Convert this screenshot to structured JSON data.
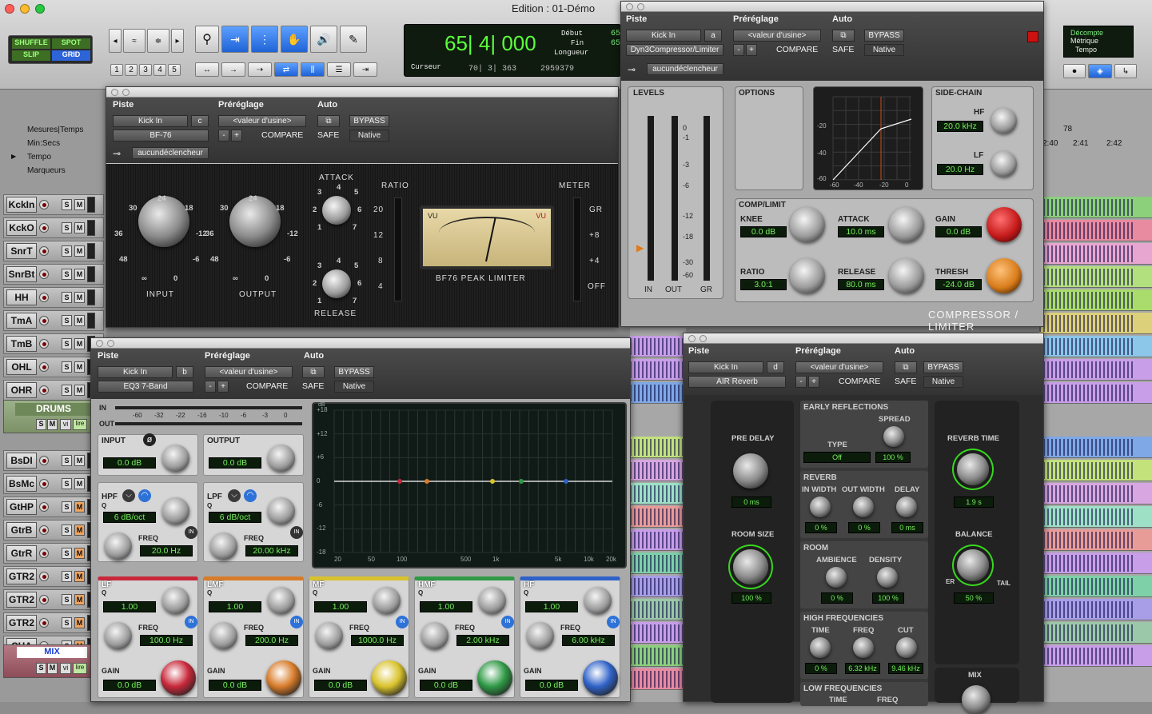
{
  "window": {
    "title": "Edition : 01-Démo"
  },
  "toolbar": {
    "modes": [
      "SHUFFLE",
      "SPOT",
      "SLIP",
      "GRID"
    ],
    "numbers": [
      "1",
      "2",
      "3",
      "4",
      "5"
    ],
    "counter": "65| 4| 000",
    "labels": {
      "start": "Début",
      "end": "Fin",
      "length": "Longueur",
      "cursor": "Curseur"
    },
    "start_val": "65",
    "end_val": "65",
    "cursor_val": "70| 3| 363",
    "sample_val": "2959379",
    "decompte": "Décompte",
    "metrique": "Métrique",
    "tempo": "Tempo"
  },
  "ruler": {
    "rows": [
      "Mesures|Temps",
      "Min:Secs",
      "Tempo",
      "Marqueurs"
    ],
    "bar": "78",
    "times": [
      "2:40",
      "2:41",
      "2:42"
    ]
  },
  "tracks": [
    {
      "name": "KckIn"
    },
    {
      "name": "KckO"
    },
    {
      "name": "SnrT"
    },
    {
      "name": "SnrBt"
    },
    {
      "name": "HH"
    },
    {
      "name": "TmA"
    },
    {
      "name": "TmB"
    },
    {
      "name": "OHL"
    },
    {
      "name": "OHR"
    },
    {
      "name": "BsDI"
    },
    {
      "name": "BsMc"
    },
    {
      "name": "GtHP"
    },
    {
      "name": "GtrB"
    },
    {
      "name": "GtrR"
    },
    {
      "name": "GTR2"
    },
    {
      "name": "GTR2"
    },
    {
      "name": "GTR2"
    },
    {
      "name": "CHA"
    }
  ],
  "group": {
    "drums": "DRUMS",
    "mix": "MIX",
    "vi": "vi",
    "lire": "lire"
  },
  "common": {
    "piste": "Piste",
    "preset": "Préréglage",
    "auto": "Auto",
    "track": "Kick In",
    "factory": "<valeur d'usine>",
    "compare": "COMPARE",
    "bypass": "BYPASS",
    "safe": "SAFE",
    "native": "Native",
    "key": "aucundéclencheur",
    "minus": "-",
    "plus": "+"
  },
  "bf76": {
    "letter": "c",
    "plugin": "BF-76",
    "input": "INPUT",
    "output": "OUTPUT",
    "attack": "ATTACK",
    "release": "RELEASE",
    "ratio": "RATIO",
    "meter": "METER",
    "ratios": [
      "20",
      "12",
      "8",
      "4"
    ],
    "meters": [
      "GR",
      "+8",
      "+4",
      "OFF"
    ],
    "title": "BF76 PEAK LIMITER",
    "vu": "VU",
    "in_ticks": [
      "24",
      "30",
      "18",
      "36",
      "-12",
      "48",
      "-6",
      "∞",
      "0"
    ],
    "out_ticks": [
      "24",
      "30",
      "18",
      "36",
      "-12",
      "48",
      "-6",
      "∞",
      "0"
    ],
    "atk_ticks": [
      "3",
      "4",
      "5",
      "2",
      "6",
      "1",
      "7"
    ],
    "rel_ticks": [
      "3",
      "4",
      "5",
      "2",
      "6",
      "1",
      "7"
    ]
  },
  "dyn3": {
    "letter": "a",
    "plugin": "Dyn3Compressor/Limiter",
    "levels": "LEVELS",
    "options": "OPTIONS",
    "sidechain": "SIDE-CHAIN",
    "complimit": "COMP/LIMIT",
    "hf": "HF",
    "hf_val": "20.0 kHz",
    "lf": "LF",
    "lf_val": "20.0 Hz",
    "knee": "KNEE",
    "knee_val": "0.0 dB",
    "attack": "ATTACK",
    "attack_val": "10.0 ms",
    "gain": "GAIN",
    "gain_val": "0.0 dB",
    "ratio": "RATIO",
    "ratio_val": "3.0:1",
    "release": "RELEASE",
    "release_val": "80.0 ms",
    "thresh": "THRESH",
    "thresh_val": "-24.0 dB",
    "scale": [
      "0",
      "-1",
      "-3",
      "-6",
      "-12",
      "-18",
      "-30",
      "-60"
    ],
    "in": "IN",
    "out": "OUT",
    "gr": "GR",
    "brand": "COMPRESSOR / LIMITER",
    "graph_y": [
      "0",
      "-20",
      "-40",
      "-60"
    ],
    "graph_x": [
      "-60",
      "-40",
      "-20",
      "0"
    ]
  },
  "eq3": {
    "letter": "b",
    "plugin": "EQ3 7-Band",
    "in": "IN",
    "out": "OUT",
    "meter_scale": [
      "-60",
      "-32",
      "-22",
      "-16",
      "-10",
      "-6",
      "-3",
      "0"
    ],
    "input": "INPUT",
    "input_val": "0.0 dB",
    "output": "OUTPUT",
    "output_val": "0.0 dB",
    "hpf": "HPF",
    "hpf_q": "Q",
    "hpf_slope": "6 dB/oct",
    "hpf_freq": "FREQ",
    "hpf_freq_val": "20.0 Hz",
    "lpf": "LPF",
    "lpf_q": "Q",
    "lpf_slope": "6 dB/oct",
    "lpf_freq": "FREQ",
    "lpf_freq_val": "20.00 kHz",
    "in_btn": "IN",
    "db_scale": [
      "+18",
      "+12",
      "+6",
      "0",
      "-6",
      "-12",
      "-18"
    ],
    "freq_scale": [
      "20",
      "50",
      "100",
      "500",
      "1k",
      "5k",
      "10k",
      "20k"
    ],
    "db_unit": "dB",
    "bands": [
      {
        "name": "LF",
        "q": "1.00",
        "freq": "100.0 Hz",
        "gain": "0.0 dB",
        "color": "#c8283a"
      },
      {
        "name": "LMF",
        "q": "1.00",
        "freq": "200.0 Hz",
        "gain": "0.0 dB",
        "color": "#d87c2a"
      },
      {
        "name": "MF",
        "q": "1.00",
        "freq": "1000.0 Hz",
        "gain": "0.0 dB",
        "color": "#d9c32c"
      },
      {
        "name": "HMF",
        "q": "1.00",
        "freq": "2.00 kHz",
        "gain": "0.0 dB",
        "color": "#2f9a46"
      },
      {
        "name": "HF",
        "q": "1.00",
        "freq": "6.00 kHz",
        "gain": "0.0 dB",
        "color": "#2f62c8"
      }
    ],
    "q_label": "Q",
    "freq_label": "FREQ",
    "gain_label": "GAIN"
  },
  "air": {
    "letter": "d",
    "plugin": "AIR Reverb",
    "pre_delay": "PRE DELAY",
    "pre_delay_val": "0 ms",
    "room_size": "ROOM SIZE",
    "room_size_val": "100 %",
    "early": "EARLY REFLECTIONS",
    "spread": "SPREAD",
    "type": "TYPE",
    "type_val": "Off",
    "spread_val": "100 %",
    "reverb": "REVERB",
    "in_width": "IN WIDTH",
    "out_width": "OUT WIDTH",
    "delay": "DELAY",
    "in_width_val": "0 %",
    "out_width_val": "0 %",
    "delay_val": "0 ms",
    "room": "ROOM",
    "ambience": "AMBIENCE",
    "density": "DENSITY",
    "ambience_val": "0 %",
    "density_val": "100 %",
    "highfreq": "HIGH FREQUENCIES",
    "time": "TIME",
    "freq": "FREQ",
    "cut": "CUT",
    "hf_time_val": "0 %",
    "hf_freq_val": "6.32 kHz",
    "hf_cut_val": "9.46 kHz",
    "lowfreq": "LOW FREQUENCIES",
    "lf_time": "TIME",
    "lf_freq": "FREQ",
    "reverb_time": "REVERB TIME",
    "reverb_time_val": "1.9 s",
    "balance": "BALANCE",
    "balance_val": "50 %",
    "er": "ER",
    "tail": "TAIL",
    "mix": "MIX"
  }
}
